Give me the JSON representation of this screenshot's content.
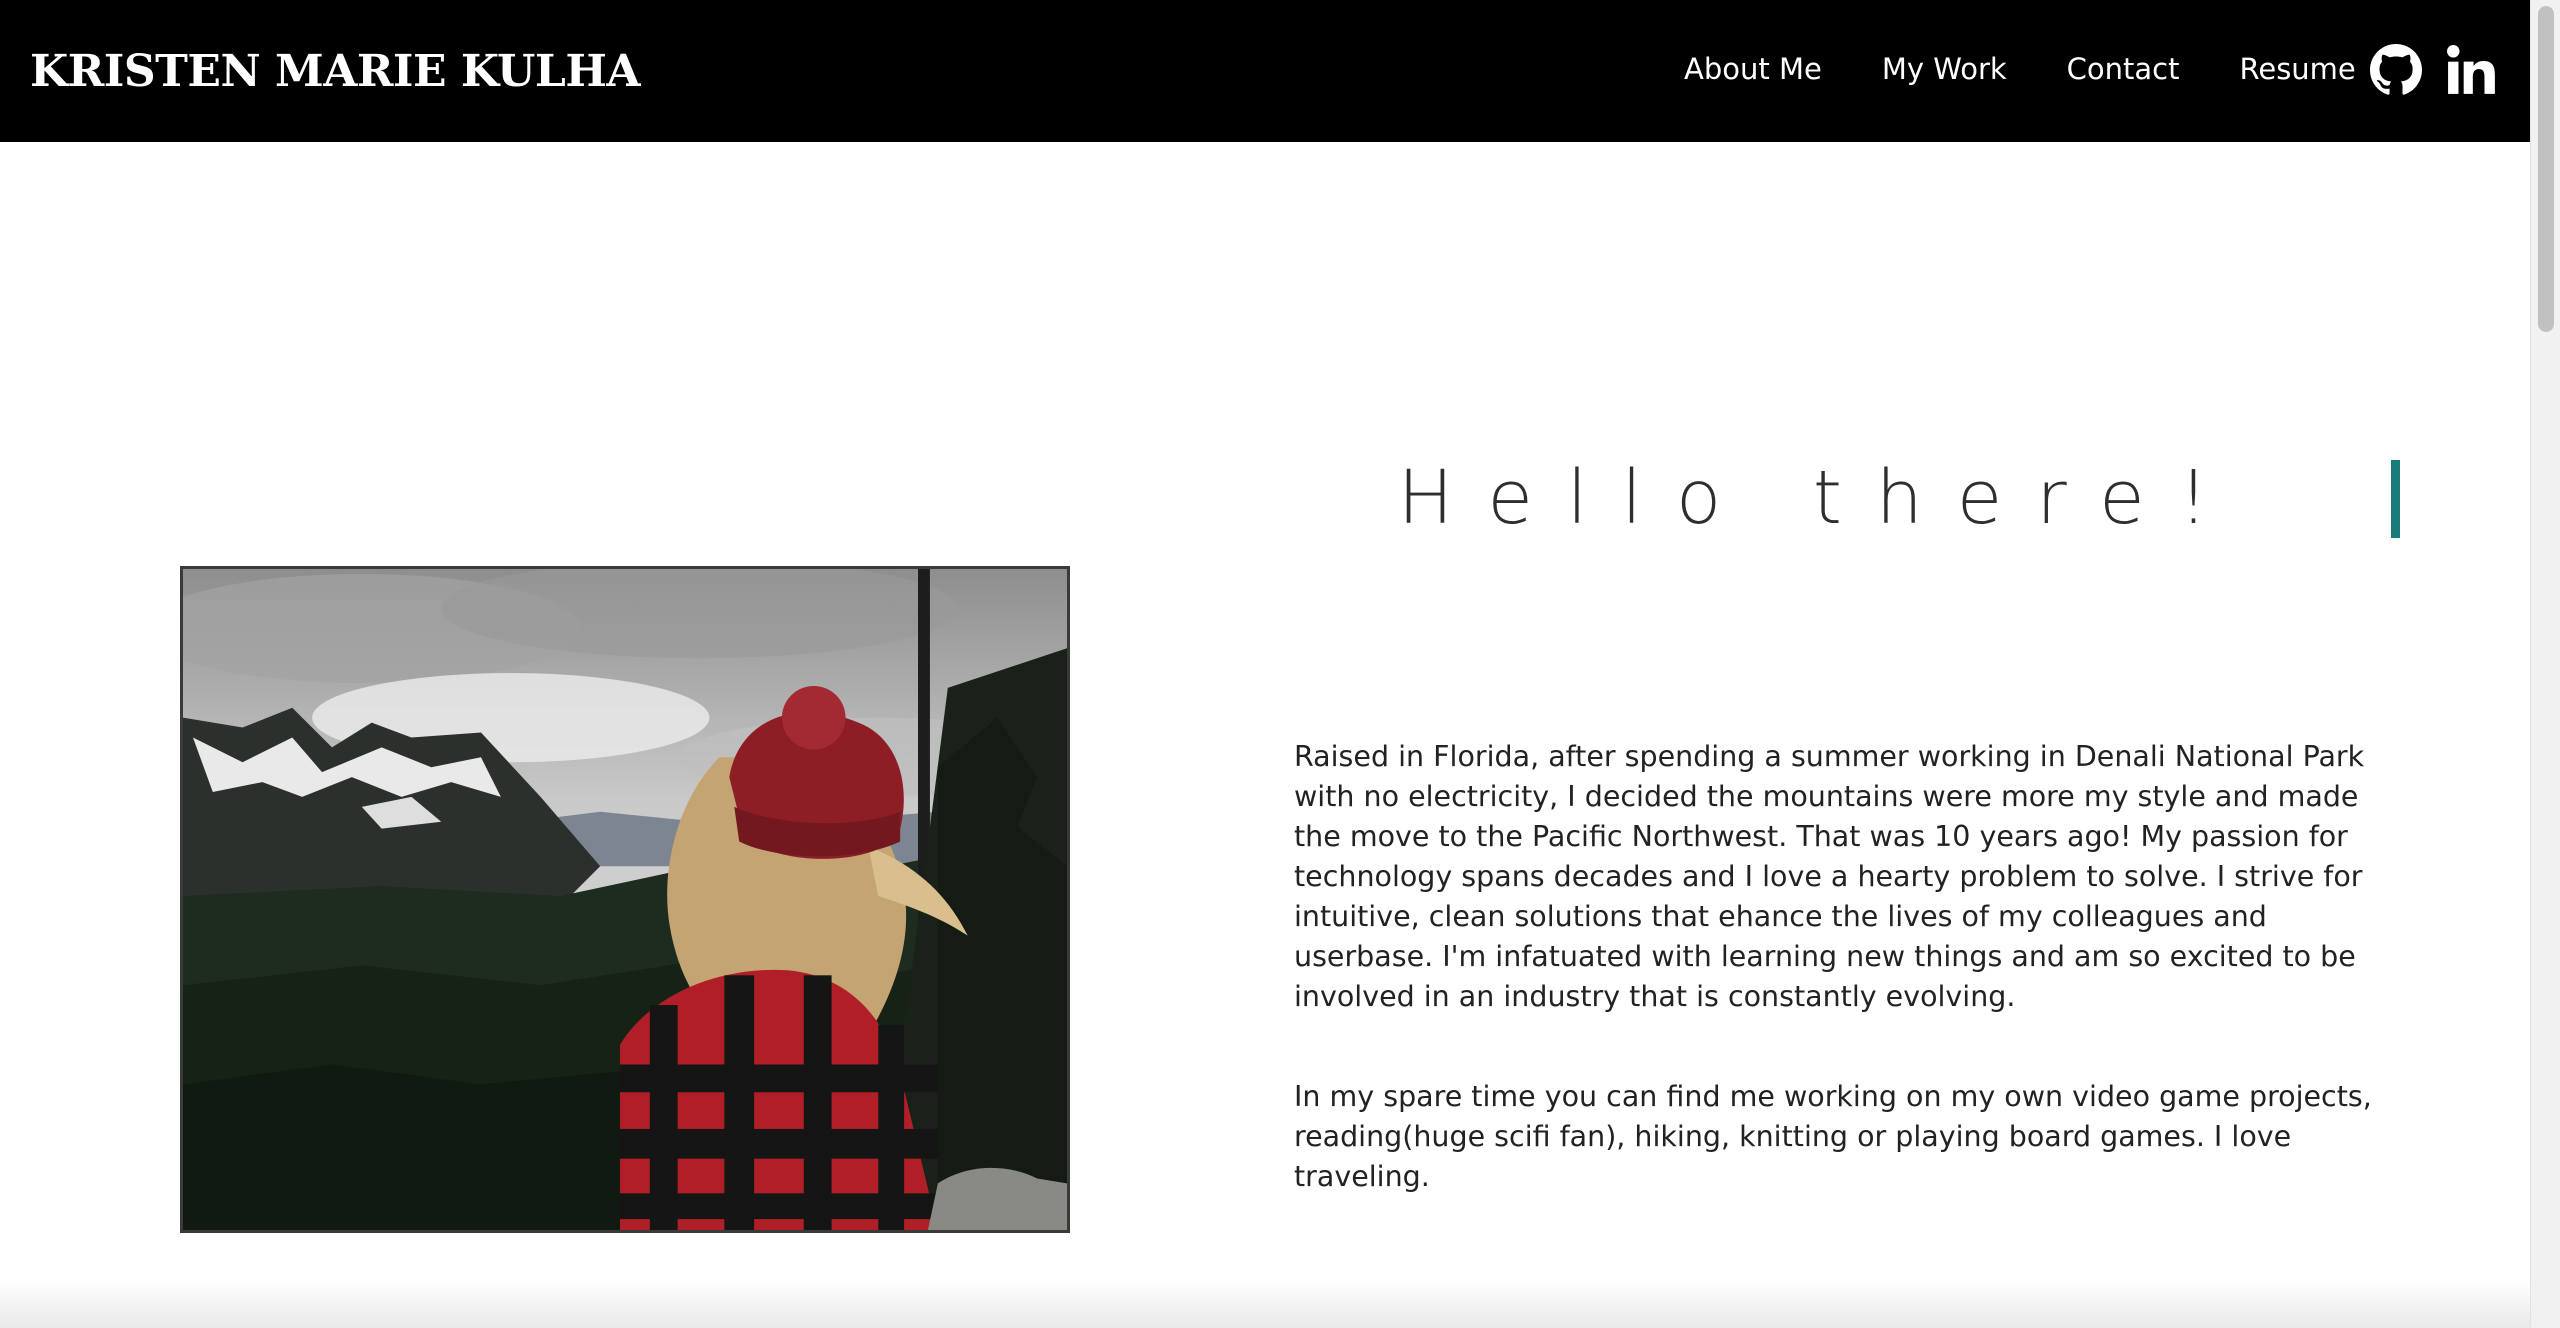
{
  "header": {
    "brand": "KRISTEN MARIE KULHA",
    "nav": [
      {
        "label": "About Me"
      },
      {
        "label": "My Work"
      },
      {
        "label": "Contact"
      },
      {
        "label": "Resume"
      }
    ],
    "social": [
      {
        "icon": "github-icon"
      },
      {
        "icon": "linkedin-icon"
      }
    ],
    "background": "#000000",
    "text_color": "#ffffff"
  },
  "main": {
    "heading": "Hello there!",
    "accent_color": "#1a7b7b",
    "bio": [
      "Raised in Florida, after spending a summer working in Denali National Park with no electricity, I decided the mountains were more my style and made the move to the Pacific Northwest. That was 10 years ago! My passion for technology spans decades and I love a hearty problem to solve. I strive for intuitive, clean solutions that ehance the lives of my colleagues and userbase. I'm infatuated with learning new things and am so excited to be involved in an industry that is constantly evolving.",
      "In my spare time you can find me working on my own video game projects, reading(huge scifi fan), hiking, knitting or playing board games. I love traveling."
    ]
  }
}
